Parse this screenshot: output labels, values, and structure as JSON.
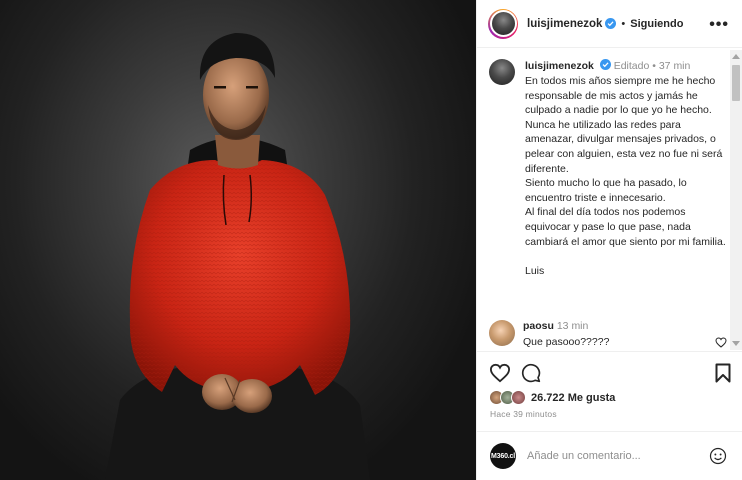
{
  "post": {
    "username": "luisjimenezok",
    "follow_status": "Siguiendo",
    "more_label": "•••",
    "caption": {
      "username": "luisjimenezok",
      "edited": "Editado",
      "age": "37 min",
      "text": "En todos mis años siempre me he hecho responsable de mis actos y jamás he culpado a nadie por lo que yo he hecho.\nNunca he utilizado las redes para amenazar, divulgar mensajes privados, o pelear con alguien, esta vez no fue ni será diferente.\nSiento mucho lo que ha pasado, lo encuentro triste e innecesario.\nAl final del día todos nos podemos equivocar y pase lo que pase, nada cambiará el amor que siento por mi familia.\n\nLuis"
    },
    "comment": {
      "username": "paosu",
      "age": "13 min",
      "text": "Que pasooo?????"
    },
    "likes_count": "26.722",
    "likes_label": "Me gusta",
    "time_ago": "Hace 39 minutos",
    "add_comment_placeholder": "Añade un comentario...",
    "commenter_logo": "M360.cl"
  },
  "icons": {
    "verified": "verified-badge-icon",
    "like": "heart-icon",
    "comment": "comment-bubble-icon",
    "save": "bookmark-icon",
    "emoji": "smiley-icon"
  },
  "colors": {
    "verified": "#3897f0",
    "sweater": "#d62a1a",
    "muted_text": "#8e8e8e"
  }
}
